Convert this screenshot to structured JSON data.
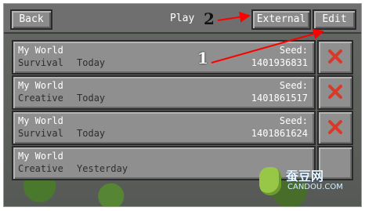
{
  "topbar": {
    "back_label": "Back",
    "play_label": "Play",
    "external_label": "External",
    "edit_label": "Edit"
  },
  "worlds": [
    {
      "name": "My World",
      "mode": "Survival",
      "date": "Today",
      "seed_label": "Seed:",
      "seed": "1401936831"
    },
    {
      "name": "My World",
      "mode": "Creative",
      "date": "Today",
      "seed_label": "Seed:",
      "seed": "1401861517"
    },
    {
      "name": "My World",
      "mode": "Survival",
      "date": "Today",
      "seed_label": "Seed:",
      "seed": "1401861624"
    },
    {
      "name": "My World",
      "mode": "Creative",
      "date": "Yesterday",
      "seed_label": "",
      "seed": ""
    }
  ],
  "annotations": {
    "label_1": "1",
    "label_2": "2"
  },
  "watermark": {
    "cn": "蚕豆网",
    "en": "CANDOU.COM"
  },
  "colors": {
    "panel": "#8f8f8f",
    "border": "#2a2a2a",
    "delete_x": "#d83a2a",
    "annotation_arrow": "#ff0000"
  },
  "icons": {
    "delete": "x-mark-icon"
  }
}
